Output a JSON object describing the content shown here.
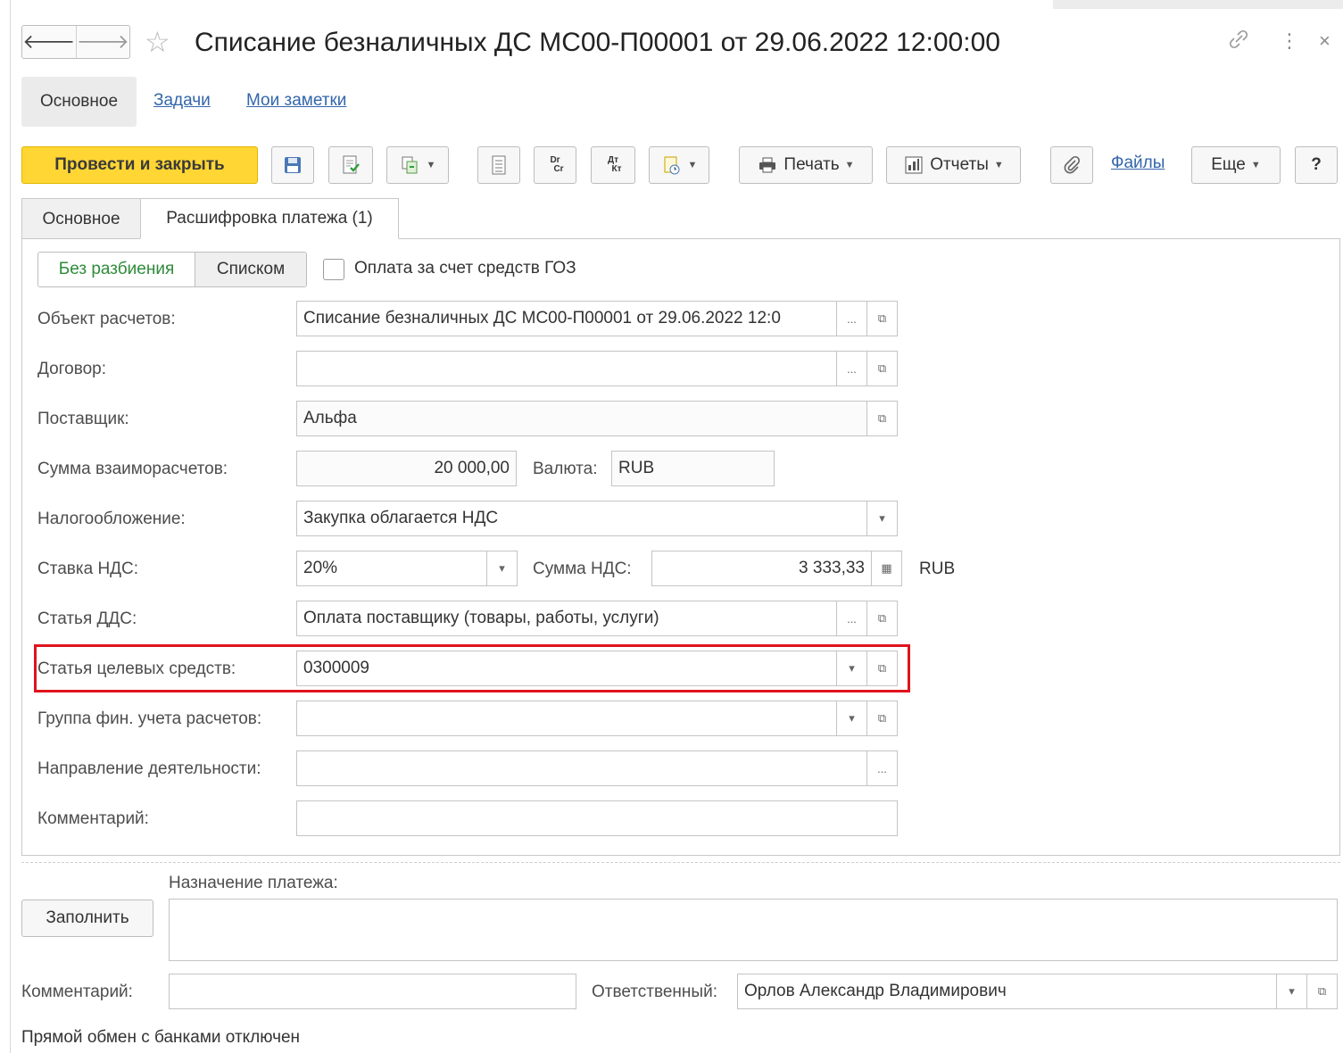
{
  "window": {
    "title": "Списание безналичных ДС МС00-П00001 от 29.06.2022 12:00:00",
    "back_glyph": "🡐",
    "forward_glyph": "🡒",
    "star_glyph": "☆",
    "link_glyph": "🔗",
    "more_glyph": "⋮",
    "close_glyph": "×"
  },
  "panel_nav": {
    "active": "Основное",
    "links": [
      "Задачи",
      "Мои заметки"
    ]
  },
  "toolbar": {
    "post_and_close": "Провести и закрыть",
    "print": "Печать",
    "reports": "Отчеты",
    "files": "Файлы",
    "more": "Еще",
    "help": "?",
    "dr_cr": "Dr Cr",
    "dt_kt": "Дт Кт"
  },
  "tabs": [
    "Основное",
    "Расшифровка платежа (1)"
  ],
  "mode": {
    "without_split": "Без разбиения",
    "list": "Списком",
    "goz_label": "Оплата за счет средств ГОЗ",
    "goz_checked": false
  },
  "form": {
    "object_label": "Объект расчетов:",
    "object_value": "Списание безналичных ДС МС00-П00001 от 29.06.2022 12:0",
    "contract_label": "Договор:",
    "contract_value": "",
    "supplier_label": "Поставщик:",
    "supplier_value": "Альфа",
    "amount_label": "Сумма взаиморасчетов:",
    "amount_value": "20 000,00",
    "currency_label": "Валюта:",
    "currency_value": "RUB",
    "tax_label": "Налогообложение:",
    "tax_value": "Закупка облагается НДС",
    "vat_rate_label": "Ставка НДС:",
    "vat_rate_value": "20%",
    "vat_sum_label": "Сумма НДС:",
    "vat_sum_value": "3 333,33",
    "vat_currency": "RUB",
    "cashflow_label": "Статья ДДС:",
    "cashflow_value": "Оплата поставщику (товары, работы, услуги)",
    "target_funds_label": "Статья целевых средств:",
    "target_funds_value": "0300009",
    "fin_group_label": "Группа фин. учета расчетов:",
    "fin_group_value": "",
    "activity_label": "Направление деятельности:",
    "activity_value": "",
    "comment_label": "Комментарий:",
    "comment_value": ""
  },
  "footer": {
    "purpose_label": "Назначение платежа:",
    "fill_button": "Заполнить",
    "purpose_value": "",
    "comment_label": "Комментарий:",
    "comment_value": "",
    "responsible_label": "Ответственный:",
    "responsible_value": "Орлов Александр Владимирович",
    "status": "Прямой обмен с банками отключен"
  },
  "glyphs": {
    "ellipsis": "...",
    "open": "⧉",
    "dropdown": "▾",
    "calculator": "▦"
  },
  "colors": {
    "primary_button": "#ffd633",
    "link": "#3366aa",
    "active_segment_text": "#2e8b3a",
    "highlight_frame": "#e0131b"
  }
}
